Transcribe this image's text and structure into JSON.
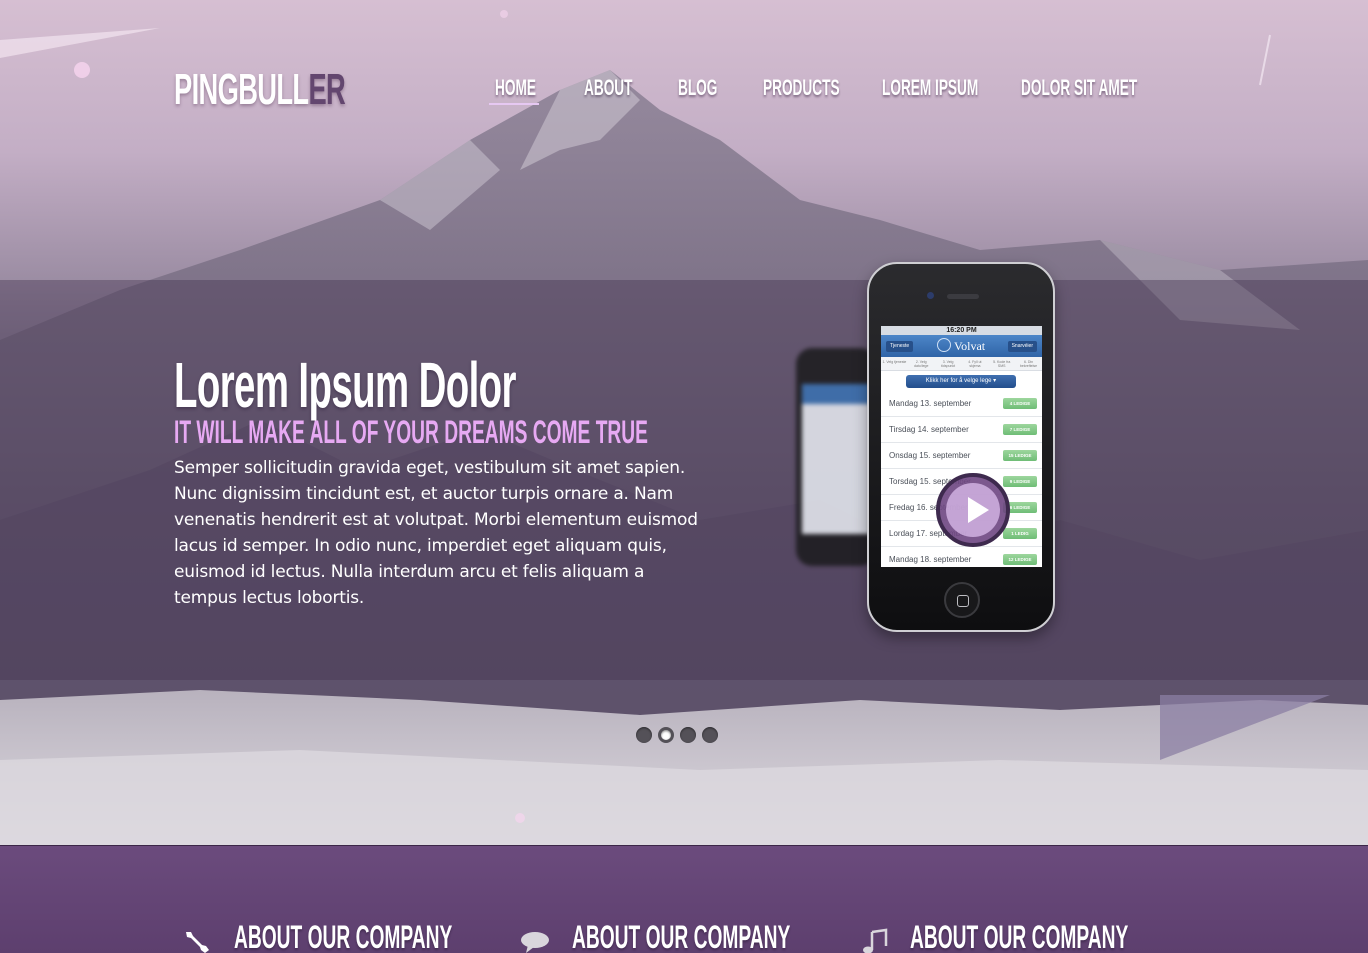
{
  "site": {
    "logo_main": "PINGBULL",
    "logo_accent": "ER"
  },
  "nav": {
    "items": [
      {
        "label": "HOME",
        "active": true
      },
      {
        "label": "ABOUT",
        "active": false
      },
      {
        "label": "BLOG",
        "active": false
      },
      {
        "label": "PRODUCTS",
        "active": false
      },
      {
        "label": "LOREM IPSUM",
        "active": false
      },
      {
        "label": "DOLOR SIT AMET",
        "active": false
      }
    ]
  },
  "slide": {
    "title": "Lorem Ipsum Dolor",
    "subtitle": "IT WILL MAKE ALL OF YOUR DREAMS COME TRUE",
    "body": "Semper sollicitudin gravida eget, vestibulum sit amet sapien. Nunc dignissim tincidunt est, et auctor turpis ornare a. Nam venenatis hendrerit est at volutpat. Morbi elementum euismod lacus id semper. In odio nunc, imperdiet eget aliquam quis, euismod id lectus. Nulla interdum arcu et felis aliquam a tempus lectus lobortis."
  },
  "phone_app": {
    "time": "16:20 PM",
    "left_button": "Tjeneste",
    "brand": "Volvat",
    "right_button": "Snarvéier",
    "steps": [
      "1. Velg tjeneste",
      "2. Velg dato/lege",
      "3. Velg tidspunkt",
      "4. Fyll ut skjema",
      "5. Kode fra SMS",
      "6. Din bekreftelse"
    ],
    "pick_button": "Klikk her for å velge lege ▾",
    "days": [
      {
        "day": "Mandag 13. september",
        "badge": "4 LEDIGE"
      },
      {
        "day": "Tirsdag 14. september",
        "badge": "7 LEDIGE"
      },
      {
        "day": "Onsdag 15. september",
        "badge": "15 LEDIGE"
      },
      {
        "day": "Torsdag 15. september",
        "badge": "9 LEDIGE"
      },
      {
        "day": "Fredag 16. september",
        "badge": "6 LEDIGE"
      },
      {
        "day": "Lordag 17. september",
        "badge": "1 LEDIG"
      },
      {
        "day": "Mandag 18. september",
        "badge": "12 LEDIGE"
      }
    ]
  },
  "slider": {
    "slide_count": 4,
    "active_index": 1
  },
  "features": [
    {
      "icon": "wrench-icon",
      "title": "ABOUT OUR COMPANY"
    },
    {
      "icon": "speech-bubble-icon",
      "title": "ABOUT OUR COMPANY"
    },
    {
      "icon": "music-note-icon",
      "title": "ABOUT OUR COMPANY"
    }
  ],
  "colors": {
    "accent_pink": "#e7a9f3",
    "logo_accent": "#63466f",
    "footer_purple": "#6b4b7d"
  }
}
